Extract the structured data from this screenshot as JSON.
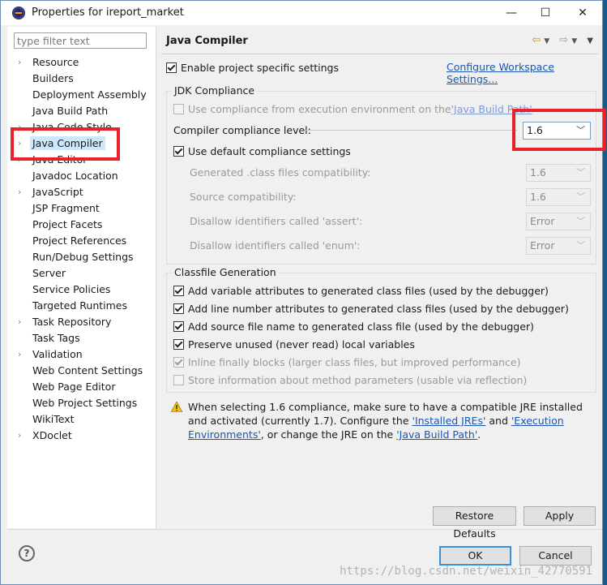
{
  "window": {
    "title": "Properties for ireport_market",
    "minimize": "—",
    "maximize": "☐",
    "close": "✕"
  },
  "sidebar": {
    "filter_placeholder": "type filter text",
    "items": [
      {
        "label": "Resource",
        "expandable": true
      },
      {
        "label": "Builders",
        "expandable": false
      },
      {
        "label": "Deployment Assembly",
        "expandable": false
      },
      {
        "label": "Java Build Path",
        "expandable": false
      },
      {
        "label": "Java Code Style",
        "expandable": true
      },
      {
        "label": "Java Compiler",
        "expandable": true,
        "selected": true
      },
      {
        "label": "Java Editor",
        "expandable": true
      },
      {
        "label": "Javadoc Location",
        "expandable": false
      },
      {
        "label": "JavaScript",
        "expandable": true
      },
      {
        "label": "JSP Fragment",
        "expandable": false
      },
      {
        "label": "Project Facets",
        "expandable": false
      },
      {
        "label": "Project References",
        "expandable": false
      },
      {
        "label": "Run/Debug Settings",
        "expandable": false
      },
      {
        "label": "Server",
        "expandable": false
      },
      {
        "label": "Service Policies",
        "expandable": false
      },
      {
        "label": "Targeted Runtimes",
        "expandable": false
      },
      {
        "label": "Task Repository",
        "expandable": true
      },
      {
        "label": "Task Tags",
        "expandable": false
      },
      {
        "label": "Validation",
        "expandable": true
      },
      {
        "label": "Web Content Settings",
        "expandable": false
      },
      {
        "label": "Web Page Editor",
        "expandable": false
      },
      {
        "label": "Web Project Settings",
        "expandable": false
      },
      {
        "label": "WikiText",
        "expandable": false
      },
      {
        "label": "XDoclet",
        "expandable": true
      }
    ]
  },
  "page": {
    "title": "Java Compiler",
    "enable_specific": "Enable project specific settings",
    "configure_workspace": "Configure Workspace Settings...",
    "jdk_group": "JDK Compliance",
    "use_env_compliance": "Use compliance from execution environment on the ",
    "java_build_path_link": "'Java Build Path'",
    "compliance_level_label": "Compiler compliance level:",
    "compliance_level_value": "1.6",
    "use_default_compliance": "Use default compliance settings",
    "generated_class_label": "Generated .class files compatibility:",
    "generated_class_value": "1.6",
    "source_compat_label": "Source compatibility:",
    "source_compat_value": "1.6",
    "assert_label": "Disallow identifiers called 'assert':",
    "assert_value": "Error",
    "enum_label": "Disallow identifiers called 'enum':",
    "enum_value": "Error",
    "classfile_group": "Classfile Generation",
    "cf_variable": "Add variable attributes to generated class files (used by the debugger)",
    "cf_line": "Add line number attributes to generated class files (used by the debugger)",
    "cf_source": "Add source file name to generated class file (used by the debugger)",
    "cf_preserve": "Preserve unused (never read) local variables",
    "cf_inline": "Inline finally blocks (larger class files, but improved performance)",
    "cf_store": "Store information about method parameters (usable via reflection)",
    "warn_1": "When selecting 1.6 compliance, make sure to have a compatible JRE installed and activated (currently 1.7). Configure the ",
    "warn_link1": "'Installed JREs'",
    "warn_and": " and ",
    "warn_link2": "'Execution Environments'",
    "warn_2": ", or change the JRE on the ",
    "warn_link3": "'Java Build Path'",
    "warn_end": "."
  },
  "buttons": {
    "restore": "Restore Defaults",
    "apply": "Apply",
    "ok": "OK",
    "cancel": "Cancel",
    "help": "?"
  },
  "watermark": "https://blog.csdn.net/weixin_42770591"
}
